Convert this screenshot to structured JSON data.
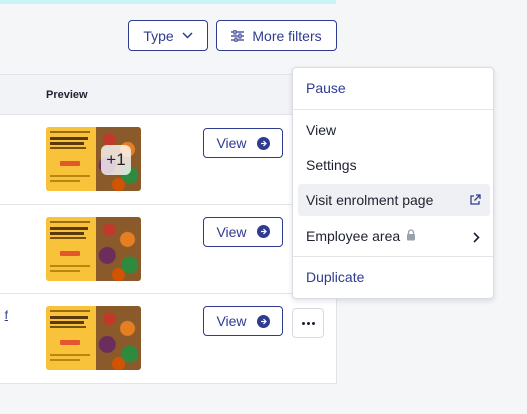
{
  "filters": {
    "type_label": "Type",
    "more_label": "More filters"
  },
  "table": {
    "preview_header": "Preview",
    "rows": [
      {
        "view_label": "View",
        "extra_count": "+1"
      },
      {
        "view_label": "View"
      },
      {
        "view_label": "View",
        "link_fragment": "f"
      }
    ]
  },
  "menu": {
    "pause": "Pause",
    "view": "View",
    "settings": "Settings",
    "visit": "Visit enrolment page",
    "employee_area": "Employee area",
    "duplicate": "Duplicate"
  },
  "colors": {
    "accent": "#2f3b8f",
    "top_strip": "#c9f3f7",
    "menu_hover": "#eef0f4"
  },
  "icons": {
    "type_chevron": "chevron-down-icon",
    "filters": "sliders-icon",
    "view_arrow": "arrow-right-circle-icon",
    "more": "ellipsis-icon",
    "external": "external-link-icon",
    "lock": "lock-icon",
    "submenu": "chevron-right-icon"
  }
}
